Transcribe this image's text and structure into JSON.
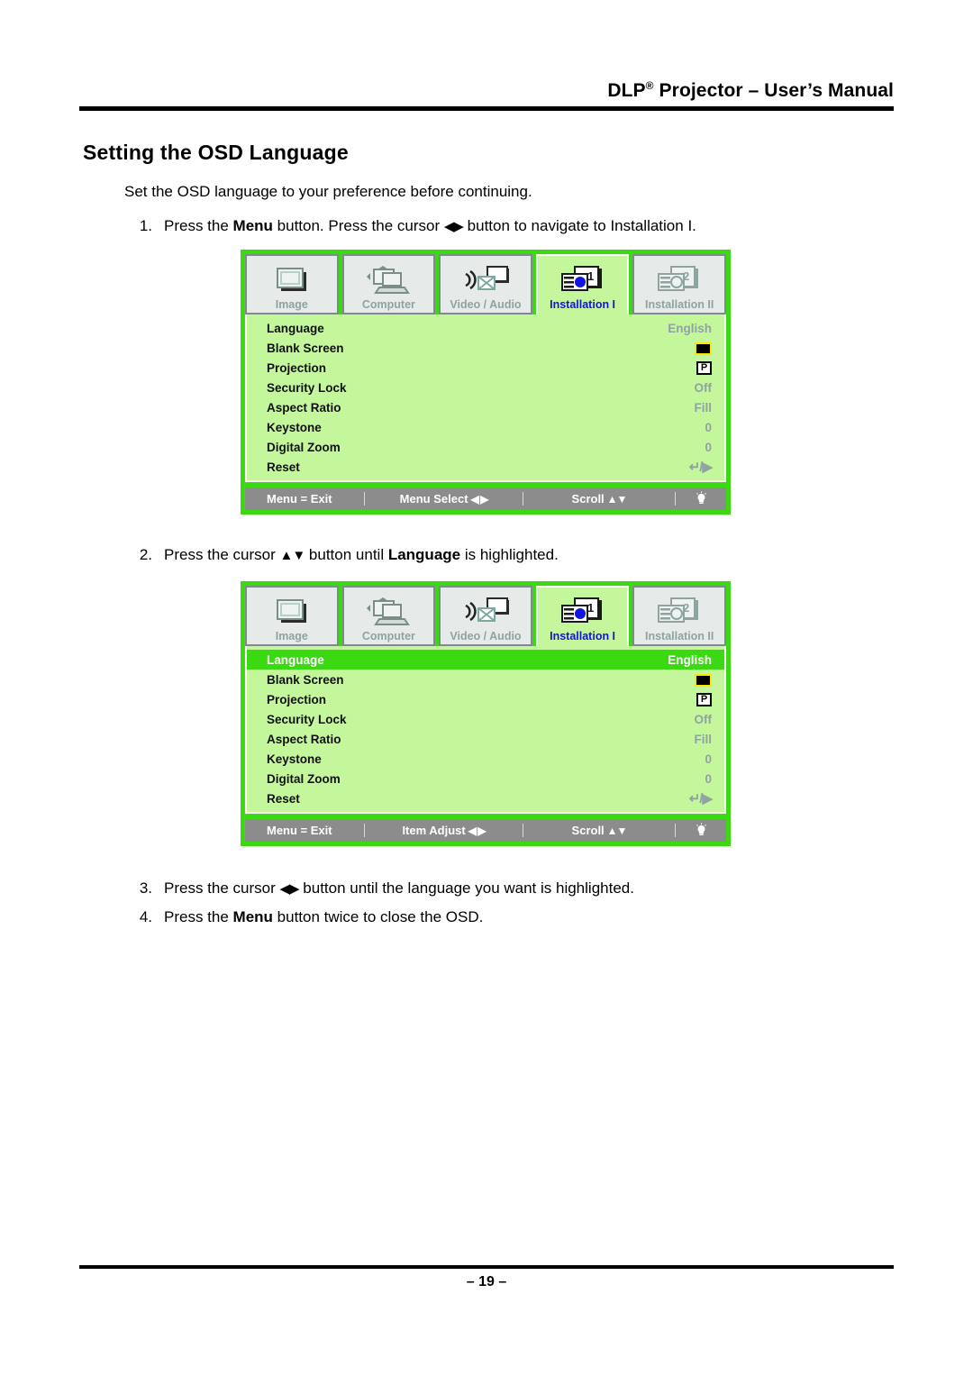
{
  "header": {
    "title_main": "DLP",
    "title_sup": "®",
    "title_rest": " Projector – User’s Manual"
  },
  "page_title": "Setting the OSD Language",
  "intro": "Set the OSD language to your preference before continuing.",
  "steps": [
    {
      "num": "1.",
      "pre": "Press the ",
      "bold": "Menu",
      "mid": " button. Press the cursor ",
      "arrows": "◀▶",
      "post": " button to navigate to Installation I."
    },
    {
      "num": "2.",
      "pre": "Press the cursor ",
      "arrows": "▲▼",
      "mid": " button until ",
      "bold": "Language",
      "post": " is highlighted."
    },
    {
      "num": "3.",
      "pre": "Press the cursor ",
      "arrows": "◀▶",
      "post": " button until the language you want is highlighted."
    },
    {
      "num": "4.",
      "pre": "Press the ",
      "bold": "Menu",
      "post": " button twice to close the OSD."
    }
  ],
  "osd": {
    "tabs": [
      {
        "label": "Image",
        "icon": "screen-icon",
        "active": false
      },
      {
        "label": "Computer",
        "icon": "laptop-icon",
        "active": false
      },
      {
        "label": "Video / Audio",
        "icon": "video-audio-icon",
        "active": false
      },
      {
        "label": "Installation I",
        "icon": "installation-one-icon",
        "active": true
      },
      {
        "label": "Installation II",
        "icon": "installation-two-icon",
        "active": false
      }
    ],
    "items": [
      {
        "label": "Language",
        "value": "English",
        "widget": "text"
      },
      {
        "label": "Blank Screen",
        "value": "",
        "widget": "black-swatch"
      },
      {
        "label": "Projection",
        "value": "P",
        "widget": "projection-icon"
      },
      {
        "label": "Security Lock",
        "value": "Off",
        "widget": "text"
      },
      {
        "label": "Aspect Ratio",
        "value": "Fill",
        "widget": "text"
      },
      {
        "label": "Keystone",
        "value": "0",
        "widget": "text"
      },
      {
        "label": "Digital Zoom",
        "value": "0",
        "widget": "text"
      },
      {
        "label": "Reset",
        "value": "↵/▶",
        "widget": "reset-icon"
      }
    ],
    "footer": {
      "exit": "Menu = Exit",
      "select_label": "Menu Select",
      "adjust_label": "Item Adjust",
      "lr_arrows": "◀ ▶",
      "scroll_label": "Scroll",
      "ud_arrows": "▲▼",
      "lamp": "lamp-icon"
    },
    "colors": {
      "frame_green": "#3bd911",
      "panel_green": "#c4f79b",
      "footer_gray": "#8c8c8c",
      "active_tab_text": "#1414e0",
      "inactive_tab_text": "#8fa3a0",
      "value_text": "#8fa3a0",
      "blank_swatch_border": "#ffe600"
    }
  },
  "page_number": "– 19 –"
}
